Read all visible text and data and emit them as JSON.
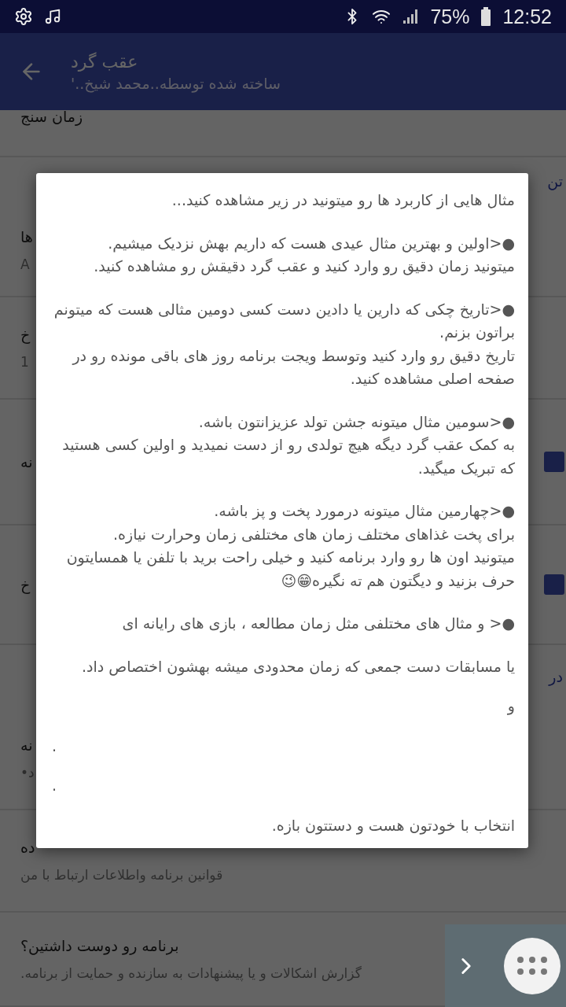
{
  "status_bar": {
    "battery": "75%",
    "time": "12:52"
  },
  "app_bar": {
    "title": "عقب گرد",
    "subtitle": "ساخته شده توسطه..محمد شیخ..'"
  },
  "background_list": [
    {
      "kind": "partial",
      "title": "زمان سنج"
    },
    {
      "kind": "category",
      "title": "تن"
    },
    {
      "kind": "row",
      "title": "ها",
      "subtitle": "A"
    },
    {
      "kind": "row",
      "title": "خ",
      "subtitle": "1"
    },
    {
      "kind": "row",
      "title": "نه",
      "checked": true
    },
    {
      "kind": "row",
      "title": "خ",
      "checked": true
    },
    {
      "kind": "category",
      "title": "در"
    },
    {
      "kind": "row",
      "title": "نه",
      "subtitle": "د•"
    },
    {
      "kind": "row",
      "title": "ده",
      "subtitle": "قوانین برنامه واطلاعات ارتباط با من"
    },
    {
      "kind": "row",
      "title": "برنامه رو دوست داشتین؟",
      "subtitle": "گزارش اشکالات و یا پیشنهادات به سازنده و حمایت از برنامه."
    }
  ],
  "dialog": {
    "paragraphs": [
      {
        "kind": "text",
        "lines": [
          "مثال هایی از کاربرد ها رو میتونید در زیر مشاهده کنید..."
        ]
      },
      {
        "kind": "text",
        "lines": [
          "●<اولین و بهترین مثال عیدی هست که داریم بهش نزدیک میشیم.",
          "میتونید زمان دقیق رو وارد کنید و عقب گرد دقیقش رو مشاهده کنید."
        ]
      },
      {
        "kind": "text",
        "lines": [
          "●<تاریخ چکی که دارین یا دادین دست کسی دومین مثالی هست که میتونم براتون بزنم.",
          "تاریخ دقیق رو وارد کنید وتوسط ویجت برنامه روز های باقی مونده رو در صفحه اصلی مشاهده کنید."
        ]
      },
      {
        "kind": "text",
        "lines": [
          "●<سومین مثال میتونه جشن تولد عزیزانتون باشه.",
          "به کمک عقب گرد دیگه هیچ تولدی رو از دست نمیدید و اولین کسی هستید که تبریک میگید."
        ]
      },
      {
        "kind": "text",
        "lines": [
          "●<چهارمین مثال میتونه درمورد پخت و پز باشه.",
          "برای پخت غذاهای مختلف زمان های مختلفی زمان وحرارت نیازه.",
          "میتونید اون ها رو وارد برنامه کنید و خیلی راحت برید با تلفن یا همسایتون حرف بزنید و دیگتون هم ته نگیره😁😉"
        ]
      },
      {
        "kind": "text",
        "lines": [
          "●< و مثال های مختلفی مثل زمان مطالعه ، بازی های رایانه ای"
        ]
      },
      {
        "kind": "text",
        "lines": [
          "یا مسابقات دست جمعی که زمان محدودی میشه بهشون اختصاص داد."
        ]
      },
      {
        "kind": "tight",
        "lines": [
          "و"
        ]
      },
      {
        "kind": "dot",
        "lines": [
          "."
        ]
      },
      {
        "kind": "dot",
        "lines": [
          "."
        ]
      },
      {
        "kind": "tight",
        "lines": [
          "انتخاب با خودتون هست و دستتون بازه."
        ]
      }
    ]
  }
}
